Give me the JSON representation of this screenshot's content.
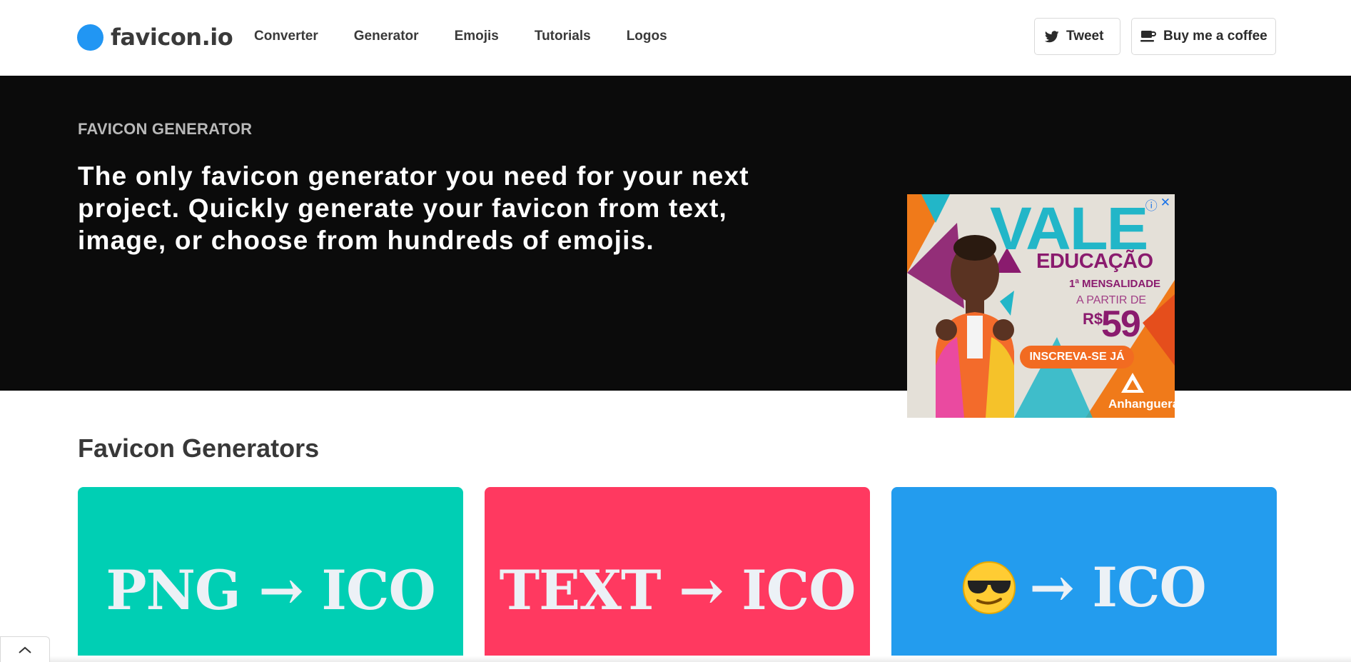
{
  "header": {
    "logo_text": "favicon.io",
    "nav": [
      "Converter",
      "Generator",
      "Emojis",
      "Tutorials",
      "Logos"
    ],
    "tweet_label": "Tweet",
    "coffee_label": "Buy me a coffee"
  },
  "hero": {
    "kicker": "FAVICON GENERATOR",
    "text": "The only favicon generator you need for your next project. Quickly generate your favicon from text, image, or choose from hundreds of emojis."
  },
  "ad": {
    "title": "VALE",
    "subtitle": "EDUCAÇÃO",
    "line1": "1ª MENSALIDADE",
    "line2": "A PARTIR DE",
    "currency": "R$",
    "price": "59",
    "cta": "INSCREVA-SE JÁ",
    "brand": "Anhanguera"
  },
  "section": {
    "title": "Favicon Generators"
  },
  "cards": [
    {
      "label": "PNG → ICO",
      "color": "#00cfb4"
    },
    {
      "label": "TEXT → ICO",
      "color": "#ff3960"
    },
    {
      "emoji": "😎",
      "label": "→ ICO",
      "color": "#239cee"
    }
  ],
  "colors": {
    "logo_dot": "#2196f3",
    "hero_bg": "#0b0b0b"
  },
  "icons": {
    "tweet": "twitter-bird-icon",
    "coffee": "coffee-cup-icon",
    "scroll": "chevron-up-icon"
  }
}
